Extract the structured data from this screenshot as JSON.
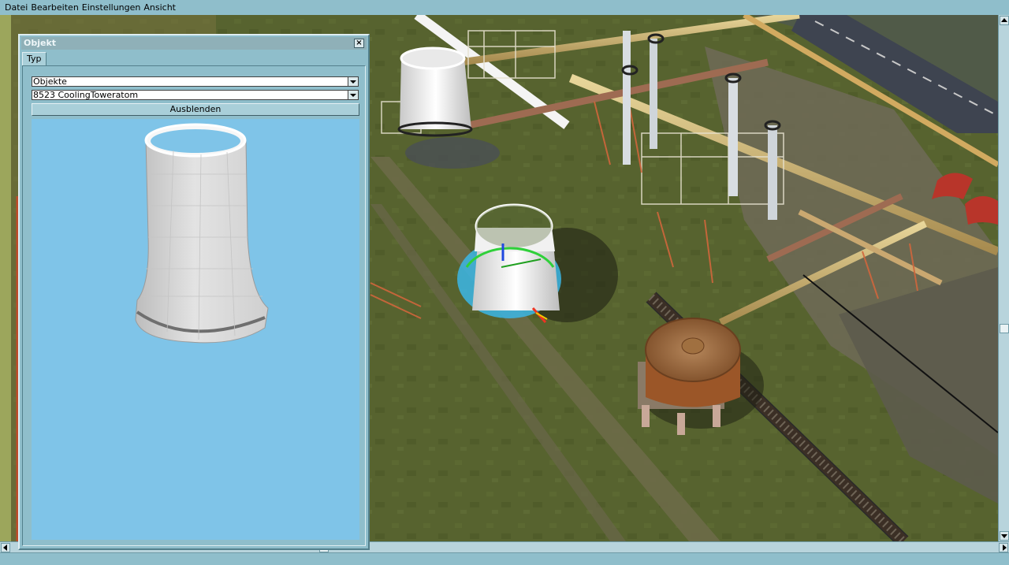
{
  "menubar": {
    "items": [
      "Datei",
      "Bearbeiten",
      "Einstellungen",
      "Ansicht"
    ]
  },
  "panel": {
    "title": "Objekt",
    "close_glyph": "×",
    "tabs": [
      {
        "label": "Typ",
        "selected": true
      }
    ],
    "category_dropdown": {
      "value": "Objekte"
    },
    "object_dropdown": {
      "value": "8523 CoolingToweratom"
    },
    "hide_button": {
      "label": "Ausblenden"
    },
    "preview": {
      "object_icon": "cooling-tower-model",
      "background": "#7fc4e8"
    }
  },
  "viewport": {
    "scene": "3d-industrial-plant-view",
    "selected_object": "cooling-tower"
  },
  "colors": {
    "chrome": "#8fbecb",
    "preview_background": "#7fc4e8",
    "ground": "#56622f"
  }
}
